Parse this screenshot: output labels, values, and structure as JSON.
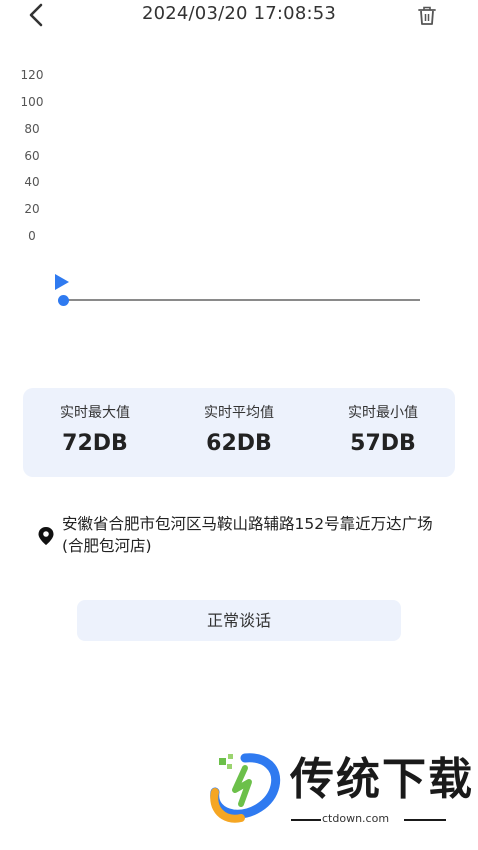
{
  "header": {
    "title": "2024/03/20 17:08:53",
    "back_icon": "chevron-left-icon",
    "delete_icon": "trash-icon"
  },
  "chart": {
    "y_ticks": [
      "120",
      "100",
      "80",
      "60",
      "40",
      "20",
      "0"
    ],
    "playback_progress": 0.0,
    "accent_color": "#2f7af0"
  },
  "stats": {
    "max": {
      "label": "实时最大值",
      "value": "72DB"
    },
    "avg": {
      "label": "实时平均值",
      "value": "62DB"
    },
    "min": {
      "label": "实时最小值",
      "value": "57DB"
    }
  },
  "location": {
    "icon": "location-pin-icon",
    "address": "安徽省合肥市包河区马鞍山路辅路152号靠近万达广场(合肥包河店)"
  },
  "category_button": {
    "label": "正常谈话"
  },
  "watermark": {
    "brand": "传统下载",
    "url": "ctdown.com"
  }
}
